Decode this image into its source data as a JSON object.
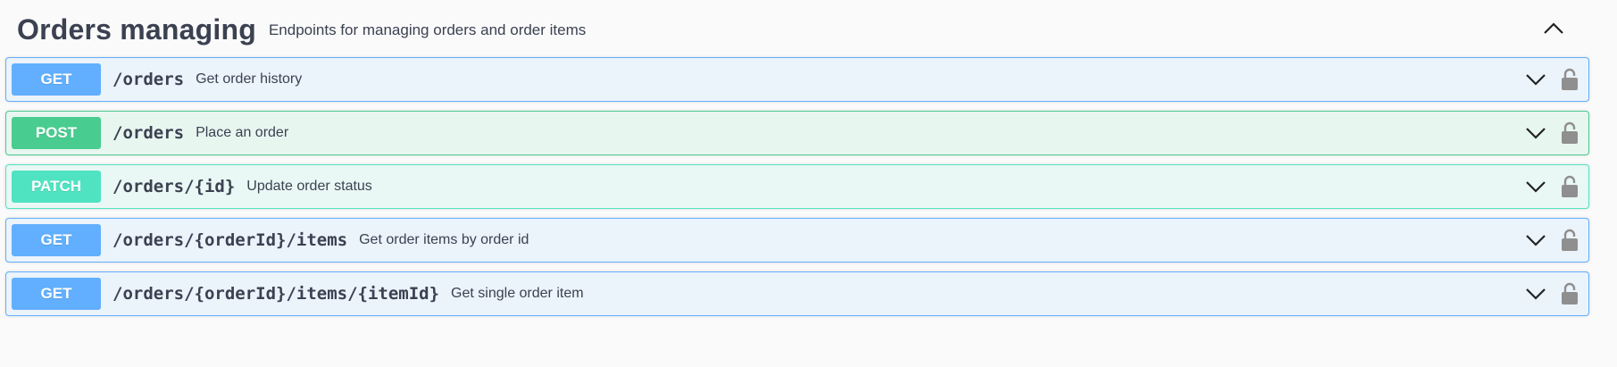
{
  "section": {
    "title": "Orders managing",
    "description": "Endpoints for managing orders and order items",
    "toggle_icon": "chevron-up-icon"
  },
  "operations": [
    {
      "method": "GET",
      "path": "/orders",
      "summary": "Get order history"
    },
    {
      "method": "POST",
      "path": "/orders",
      "summary": "Place an order"
    },
    {
      "method": "PATCH",
      "path": "/orders/{id}",
      "summary": "Update order status"
    },
    {
      "method": "GET",
      "path": "/orders/{orderId}/items",
      "summary": "Get order items by order id"
    },
    {
      "method": "GET",
      "path": "/orders/{orderId}/items/{itemId}",
      "summary": "Get single order item"
    }
  ],
  "colors": {
    "get": "#61affe",
    "post": "#49cc90",
    "patch": "#50e3c2",
    "text": "#3b4151"
  },
  "icons": {
    "expand": "chevron-down-icon",
    "auth": "lock-icon"
  }
}
